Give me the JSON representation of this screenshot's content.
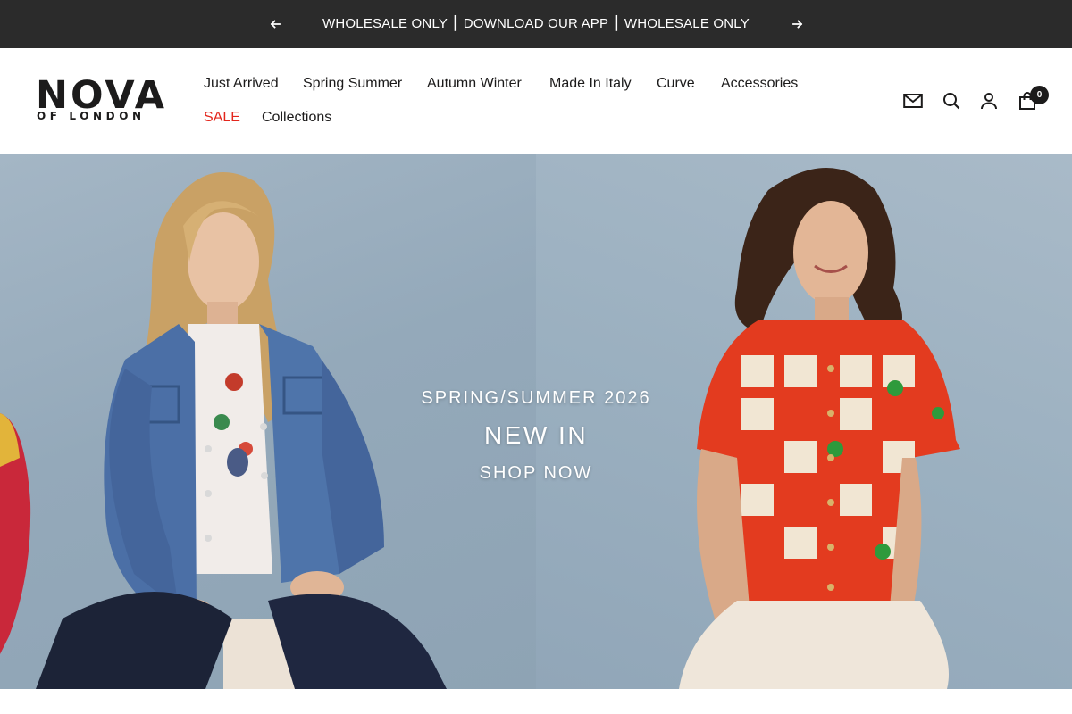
{
  "announcement": {
    "text": "WHOLESALE ONLY ┃ DOWNLOAD OUR APP ┃ WHOLESALE ONLY",
    "prev_icon": "arrow-left-icon",
    "next_icon": "arrow-right-icon"
  },
  "brand": {
    "logo_main": "NOVA",
    "logo_sub": "OF LONDON"
  },
  "nav": {
    "items": [
      {
        "label": "Just Arrived"
      },
      {
        "label": "Spring Summer"
      },
      {
        "label": "Autumn Winter"
      },
      {
        "label": "Made In Italy"
      },
      {
        "label": "Curve"
      },
      {
        "label": "Accessories"
      },
      {
        "label": "SALE",
        "highlight": true
      },
      {
        "label": "Collections"
      }
    ],
    "sale_color": "#e3261c"
  },
  "header_icons": {
    "mail": "mail-icon",
    "search": "search-icon",
    "account": "user-icon",
    "cart": "shopping-bag-icon",
    "cart_count": "0"
  },
  "hero": {
    "kicker": "SPRING/SUMMER 2026",
    "title": "NEW IN",
    "cta": "SHOP NOW",
    "left_image": "model in denim jacket and white graphic tee",
    "right_image": "model in red crochet cherry cardigan"
  },
  "colors": {
    "announcement_bg": "#2b2b2b",
    "text": "#1c1b1b",
    "hero_bg": "#9aaebf"
  }
}
